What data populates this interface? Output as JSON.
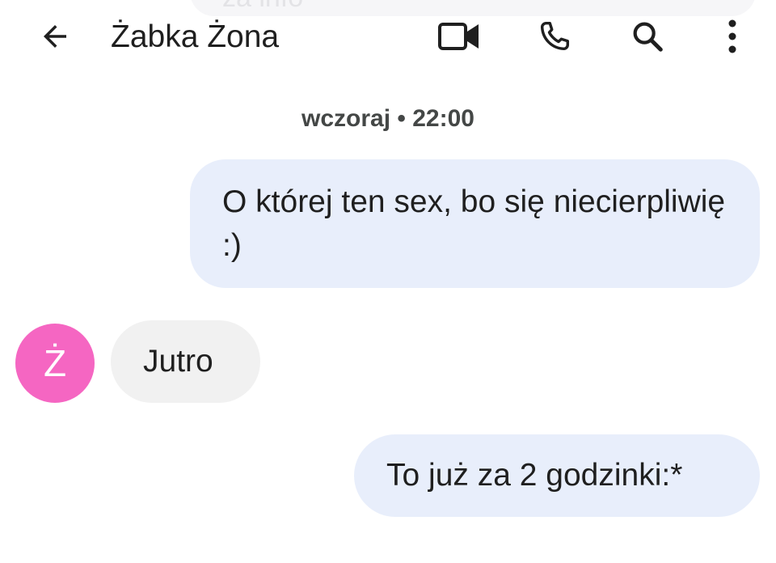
{
  "header": {
    "title": "Żabka Żona",
    "back_icon": "arrow-back-icon",
    "video_icon": "videocam-icon",
    "call_icon": "phone-icon",
    "search_icon": "search-icon",
    "more_icon": "more-vert-icon"
  },
  "conversation": {
    "timestamp": "wczoraj • 22:00",
    "messages": [
      {
        "direction": "outgoing",
        "text": "O której ten sex, bo się niecierpliwię :)"
      },
      {
        "direction": "incoming",
        "text": "Jutro",
        "avatar_letter": "Ż"
      },
      {
        "direction": "outgoing",
        "text": "To już za 2 godzinki:*"
      }
    ]
  },
  "colors": {
    "outgoing_bubble": "#e8eefb",
    "incoming_bubble": "#f1f1f1",
    "avatar": "#f566c2"
  }
}
